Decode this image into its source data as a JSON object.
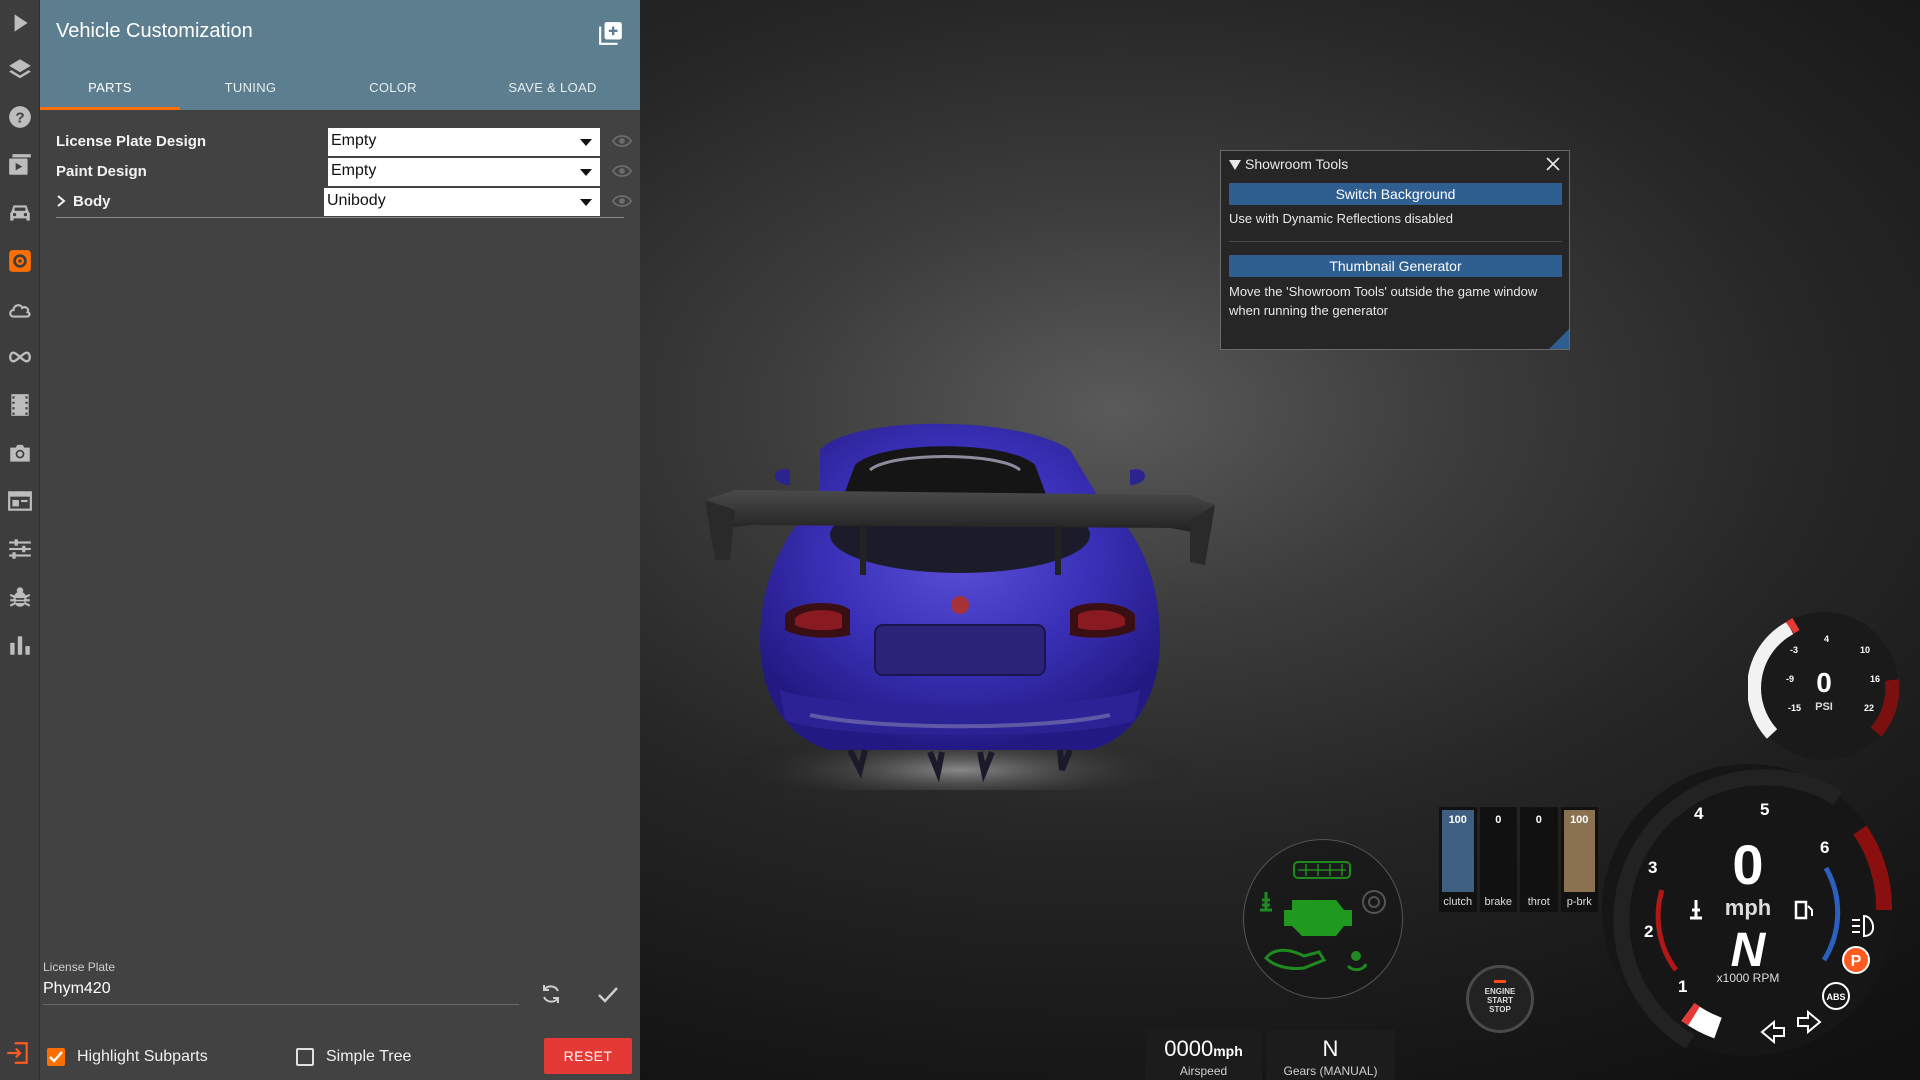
{
  "rail": {
    "icons": [
      "play-icon",
      "layers-icon",
      "help-icon",
      "video-icon",
      "car-icon",
      "customize-icon",
      "cloud-icon",
      "infinity-icon",
      "film-icon",
      "camera-icon",
      "window-icon",
      "sliders-icon",
      "bug-icon",
      "bar-chart-icon"
    ],
    "active": "customize-icon",
    "accent": "#ff6f00"
  },
  "panel": {
    "title": "Vehicle Customization",
    "tabs": [
      {
        "label": "PARTS",
        "active": true
      },
      {
        "label": "TUNING",
        "active": false
      },
      {
        "label": "COLOR",
        "active": false
      },
      {
        "label": "SAVE & LOAD",
        "active": false
      }
    ],
    "properties": [
      {
        "label": "License Plate Design",
        "value": "Empty"
      },
      {
        "label": "Paint Design",
        "value": "Empty"
      },
      {
        "label": "Body",
        "value": "Unibody"
      }
    ],
    "license_plate": {
      "label": "License Plate",
      "value": "Phym420"
    },
    "highlight_subparts": {
      "label": "Highlight Subparts",
      "checked": true
    },
    "simple_tree": {
      "label": "Simple Tree",
      "checked": false
    },
    "reset_label": "RESET",
    "header_color": "#5d7e8e"
  },
  "showroom_tools": {
    "title": "Showroom Tools",
    "switch_background": "Switch Background",
    "switch_background_desc": "Use with Dynamic Reflections disabled",
    "thumbnail_generator": "Thumbnail Generator",
    "thumbnail_generator_desc": "Move the 'Showroom Tools' outside the game window when running the generator"
  },
  "hud": {
    "pedals": [
      {
        "label": "clutch",
        "value": "100",
        "level": 1.0,
        "color": "#3e5f7f"
      },
      {
        "label": "brake",
        "value": "0",
        "level": 0.0,
        "color": "#7a2222"
      },
      {
        "label": "throt",
        "value": "0",
        "level": 0.0,
        "color": "#2f6b2f"
      },
      {
        "label": "p-brk",
        "value": "100",
        "level": 1.0,
        "color": "#8a7150"
      }
    ],
    "airspeed": {
      "value": "0000",
      "unit": "mph",
      "label": "Airspeed"
    },
    "gear_box": {
      "value": "N",
      "label": "Gears (MANUAL)"
    },
    "engine_button": [
      "ENGINE",
      "START",
      "STOP"
    ],
    "boost": {
      "value": "0",
      "unit": "PSI",
      "ticks": [
        "-15",
        "-9",
        "-3",
        "4",
        "10",
        "16",
        "22"
      ]
    },
    "tach": {
      "speed": "0",
      "speed_unit": "mph",
      "gear": "N",
      "rpm_label": "x1000 RPM",
      "ticks": [
        "1",
        "2",
        "3",
        "4",
        "5",
        "6"
      ],
      "parking": "P",
      "abs": "ABS"
    }
  }
}
